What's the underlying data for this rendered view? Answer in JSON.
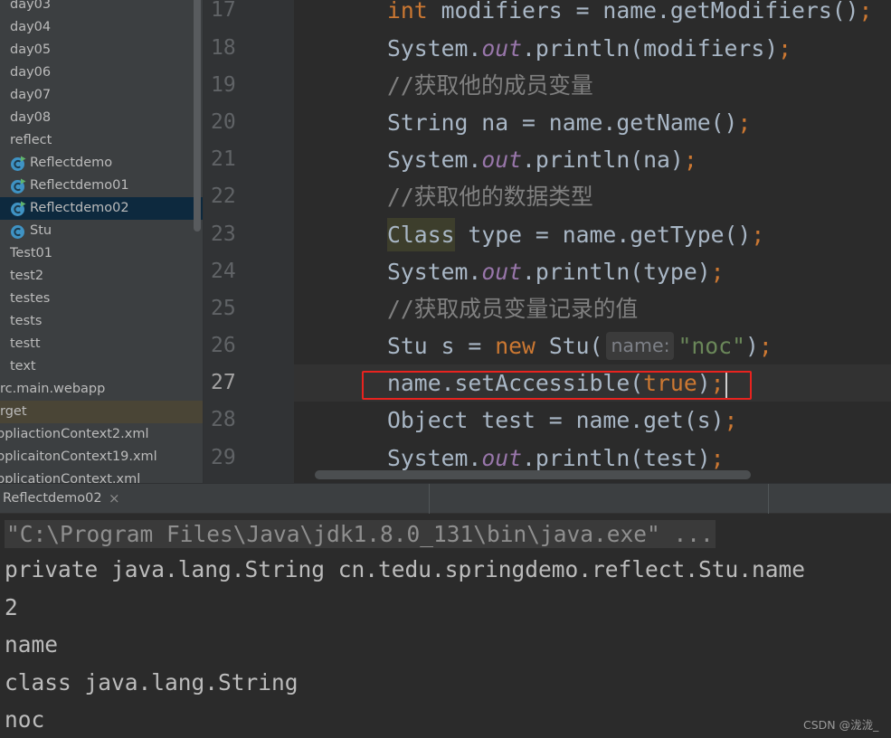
{
  "window": {
    "watermark": "CSDN @泷泷_"
  },
  "colors": {
    "sidebar_bg": "#3c3f41",
    "selected_row_bg": "#0d293e",
    "excluded_row_bg": "#4a4536",
    "editor_bg": "#2b2b2b",
    "gutter_bg": "#313335",
    "current_line_bg": "#323232",
    "annotation_red": "#e8231f"
  },
  "sidebar": {
    "items": [
      {
        "label": "day03"
      },
      {
        "label": "day04"
      },
      {
        "label": "day05"
      },
      {
        "label": "day06"
      },
      {
        "label": "day07"
      },
      {
        "label": "day08"
      },
      {
        "label": "reflect"
      },
      {
        "label": "Reflectdemo",
        "icon": "runnable-class-icon"
      },
      {
        "label": "Reflectdemo01",
        "icon": "runnable-class-icon"
      },
      {
        "label": "Reflectdemo02",
        "icon": "runnable-class-icon",
        "selected": true
      },
      {
        "label": "Stu",
        "icon": "class-icon"
      },
      {
        "label": "Test01"
      },
      {
        "label": "test2"
      },
      {
        "label": "testes"
      },
      {
        "label": "tests"
      },
      {
        "label": "testt"
      },
      {
        "label": "text"
      },
      {
        "label": "rc.main.webapp"
      },
      {
        "label": "rget",
        "excluded": true
      },
      {
        "label": "ppliactionContext2.xml"
      },
      {
        "label": "pplicaitonContext19.xml"
      },
      {
        "label": "pplicationContext.xml"
      }
    ]
  },
  "editor": {
    "lines": [
      {
        "number": "17",
        "tokens": [
          {
            "v": "int",
            "color": "#cc7832"
          },
          {
            "v": " modifiers = name.getModifiers()"
          },
          {
            "v": ";",
            "color": "#cc7832"
          }
        ]
      },
      {
        "number": "18",
        "tokens": [
          {
            "v": "System."
          },
          {
            "v": "out",
            "color": "#9876aa",
            "italic": true
          },
          {
            "v": ".println(modifiers)"
          },
          {
            "v": ";",
            "color": "#cc7832"
          }
        ]
      },
      {
        "number": "19",
        "tokens": [
          {
            "v": "//获取他的成员变量",
            "color": "#808080"
          }
        ]
      },
      {
        "number": "20",
        "tokens": [
          {
            "v": "String na = name.getName()"
          },
          {
            "v": ";",
            "color": "#cc7832"
          }
        ]
      },
      {
        "number": "21",
        "tokens": [
          {
            "v": "System."
          },
          {
            "v": "out",
            "color": "#9876aa",
            "italic": true
          },
          {
            "v": ".println(na)"
          },
          {
            "v": ";",
            "color": "#cc7832"
          }
        ]
      },
      {
        "number": "22",
        "tokens": [
          {
            "v": "//获取他的数据类型",
            "color": "#808080"
          }
        ]
      },
      {
        "number": "23",
        "tokens": [
          {
            "v": "Class",
            "bg": "#3d3e2c"
          },
          {
            "v": " type = name.getType()"
          },
          {
            "v": ";",
            "color": "#cc7832"
          }
        ]
      },
      {
        "number": "24",
        "tokens": [
          {
            "v": "System."
          },
          {
            "v": "out",
            "color": "#9876aa",
            "italic": true
          },
          {
            "v": ".println(type)"
          },
          {
            "v": ";",
            "color": "#cc7832"
          }
        ]
      },
      {
        "number": "25",
        "tokens": [
          {
            "v": "//获取成员变量记录的值",
            "color": "#808080"
          }
        ]
      },
      {
        "number": "26",
        "tokens": [
          {
            "v": "Stu s = "
          },
          {
            "v": "new",
            "color": "#cc7832"
          },
          {
            "v": " Stu("
          },
          {
            "v": "name:",
            "hint": true
          },
          {
            "v": "\"noc\"",
            "color": "#6a8759"
          },
          {
            "v": ")"
          },
          {
            "v": ";",
            "color": "#cc7832"
          }
        ]
      },
      {
        "number": "27",
        "current": true,
        "caret": true,
        "boxed": true,
        "tokens": [
          {
            "v": "name.setAccessible("
          },
          {
            "v": "true",
            "color": "#cc7832"
          },
          {
            "v": ")"
          },
          {
            "v": ";",
            "color": "#cc7832"
          }
        ]
      },
      {
        "number": "28",
        "tokens": [
          {
            "v": "Object test = name.get(s)"
          },
          {
            "v": ";",
            "color": "#cc7832"
          }
        ]
      },
      {
        "number": "29",
        "tokens": [
          {
            "v": "System."
          },
          {
            "v": "out",
            "color": "#9876aa",
            "italic": true
          },
          {
            "v": ".println(test)"
          },
          {
            "v": ";",
            "color": "#cc7832"
          }
        ]
      }
    ]
  },
  "run_panel": {
    "tab_label": "Reflectdemo02",
    "close_glyph": "×",
    "console_lines": [
      {
        "text": "\"C:\\Program Files\\Java\\jdk1.8.0_131\\bin\\java.exe\" ...",
        "folded": true
      },
      {
        "text": "private java.lang.String cn.tedu.springdemo.reflect.Stu.name"
      },
      {
        "text": "2"
      },
      {
        "text": "name"
      },
      {
        "text": "class java.lang.String"
      },
      {
        "text": "noc"
      }
    ]
  }
}
